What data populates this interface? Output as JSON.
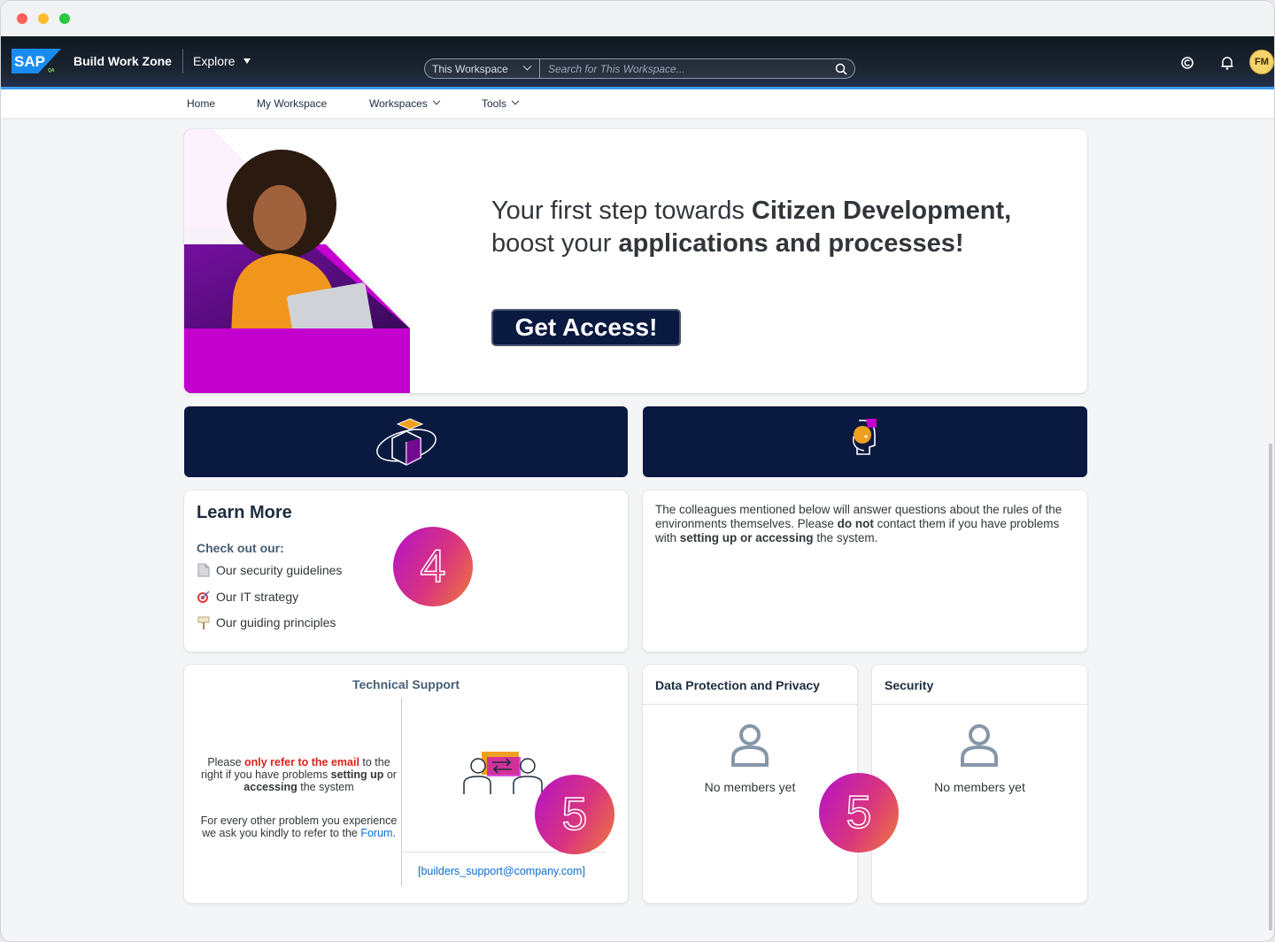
{
  "shell": {
    "app_title": "Build Work Zone",
    "explore_label": "Explore",
    "logo_text": "SAP",
    "logo_tag": "QA",
    "search_scope": "This Workspace",
    "search_placeholder": "Search for This Workspace...",
    "avatar_initials": "FM"
  },
  "nav": {
    "home": "Home",
    "my_workspace": "My Workspace",
    "workspaces": "Workspaces",
    "tools": "Tools"
  },
  "banner": {
    "line1_prefix": "Your first step towards ",
    "line1_bold": "Citizen Development,",
    "line2_prefix": "boost your ",
    "line2_bold": "applications and processes!",
    "cta": "Get Access!"
  },
  "learn": {
    "title": "Learn More",
    "subtitle": "Check out our:",
    "links": [
      "Our security guidelines",
      "Our IT strategy",
      "Our guiding principles"
    ],
    "badge": "4"
  },
  "colleagues": {
    "text_1": "The colleagues mentioned below will answer questions about the rules of the environments themselves. Please ",
    "bold_1": "do not",
    "text_2": " contact them if you have problems with ",
    "bold_2": "setting up or accessing",
    "text_3": " the system."
  },
  "support": {
    "title": "Technical Support",
    "p1_a": "Please ",
    "p1_red": "only refer to the email",
    "p1_b": " to the right if you have problems ",
    "p1_bold1": "setting up",
    "p1_c": " or ",
    "p1_bold2": "accessing",
    "p1_d": " the system",
    "p2_a": "For every other problem you experience we ask you kindly to refer to the ",
    "p2_link": "Forum",
    "p2_b": ".",
    "email": "[builders_support@company.com]",
    "badge": "5"
  },
  "data_protection": {
    "title": "Data Protection and Privacy",
    "empty": "No members yet",
    "badge": "5"
  },
  "security": {
    "title": "Security",
    "empty": "No members yet"
  },
  "colors": {
    "shell_bg": "#101820",
    "accent_blue": "#3b9cf2",
    "navy": "#0a1940",
    "banner_magenta": "#c400cf",
    "link": "#0a6ed1",
    "warning_red": "#e0201a"
  }
}
